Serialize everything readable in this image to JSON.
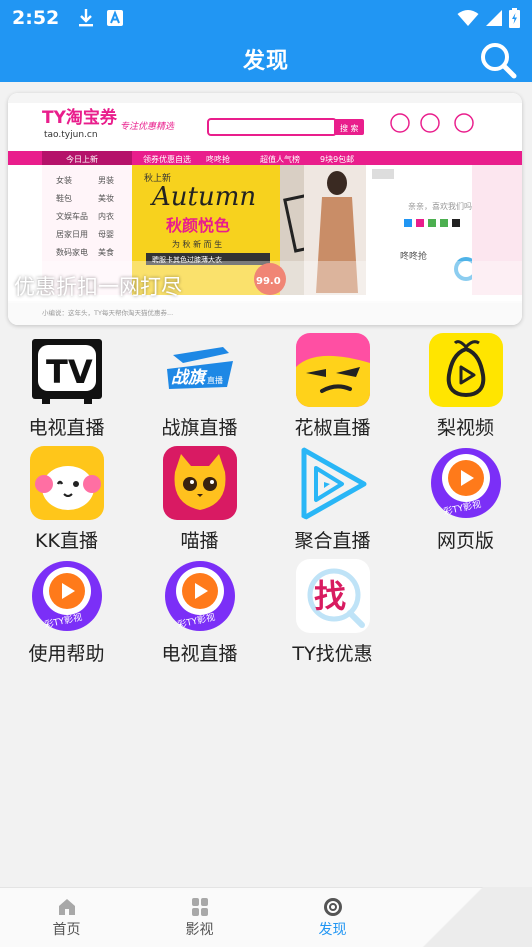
{
  "status_bar": {
    "time": "2:52",
    "icons": [
      "download-icon",
      "a-letter-icon",
      "wifi-icon",
      "signal-icon",
      "battery-icon"
    ]
  },
  "header": {
    "title": "发现",
    "search_icon": "search-icon"
  },
  "banner": {
    "caption": "优惠折扣一网打尽",
    "site_name": "TY淘宝券",
    "site_url": "tao.tyjun.cn",
    "site_slogan": "专注优惠精选",
    "search_button": "搜 索",
    "nav_items": [
      "今日上新",
      "领券优惠自选",
      "咚咚抢",
      "超值人气榜",
      "9块9包邮"
    ],
    "promo_title": "Autumn",
    "promo_season_tag": "秋上新",
    "promo_subtitle": "秋颜悦色",
    "promo_tagline": "为 秋 新 而 生",
    "promo_offer": "聘服卡其色过膝薄大衣",
    "promo_price": "99.0",
    "sidebar_categories": [
      "女装",
      "男装",
      "鞋包",
      "美妆",
      "文娱车品",
      "内衣",
      "居家日用",
      "母婴",
      "数码家电",
      "美食"
    ],
    "right_panel_title": "咚咚抢"
  },
  "apps": [
    {
      "label": "电视直播",
      "icon": "tv-icon"
    },
    {
      "label": "战旗直播",
      "icon": "zhanqi-logo-icon"
    },
    {
      "label": "花椒直播",
      "icon": "huajiao-face-icon"
    },
    {
      "label": "梨视频",
      "icon": "pear-play-icon"
    },
    {
      "label": "KK直播",
      "icon": "kk-face-icon"
    },
    {
      "label": "喵播",
      "icon": "cat-face-icon"
    },
    {
      "label": "聚合直播",
      "icon": "triangle-play-icon"
    },
    {
      "label": "网页版",
      "icon": "ty-play-icon"
    },
    {
      "label": "使用帮助",
      "icon": "ty-play-icon"
    },
    {
      "label": "电视直播",
      "icon": "ty-play-icon"
    },
    {
      "label": "TY找优惠",
      "icon": "find-icon"
    }
  ],
  "ty_badge_text": "彩TY影视",
  "find_char": "找",
  "bottom_nav": [
    {
      "label": "首页",
      "icon": "home-icon",
      "active": false
    },
    {
      "label": "影视",
      "icon": "grid-icon",
      "active": false
    },
    {
      "label": "发现",
      "icon": "compass-icon",
      "active": true
    }
  ],
  "colors": {
    "primary": "#2196f3",
    "banner_pink": "#e91e8c"
  }
}
